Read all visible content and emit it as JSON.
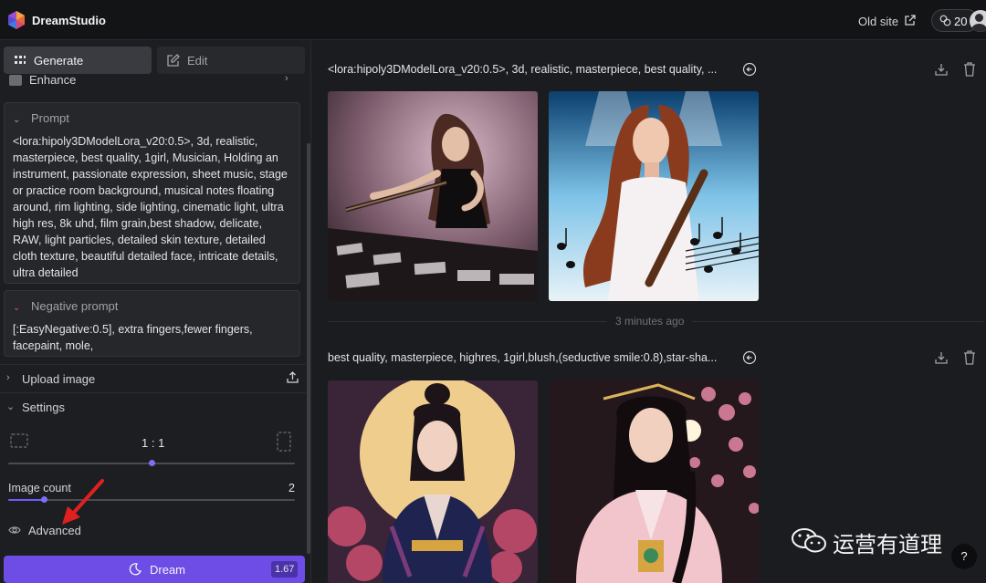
{
  "app": {
    "name": "DreamStudio"
  },
  "topbar": {
    "old_site_label": "Old site",
    "credits": "20"
  },
  "tabs": {
    "generate": "Generate",
    "edit": "Edit"
  },
  "sidebar": {
    "enhance_label": "Enhance",
    "prompt": {
      "header": "Prompt",
      "text": "<lora:hipoly3DModelLora_v20:0.5>, 3d, realistic, masterpiece, best quality, 1girl, Musician, Holding an instrument, passionate expression, sheet music, stage or practice room background, musical notes floating around, rim lighting, side lighting, cinematic light, ultra high res, 8k uhd, film grain,best shadow, delicate, RAW, light particles, detailed skin texture, detailed cloth texture, beautiful detailed face, intricate details, ultra detailed"
    },
    "negative_prompt": {
      "header": "Negative prompt",
      "text": "[:EasyNegative:0.5], extra fingers,fewer fingers, facepaint, mole,"
    },
    "upload_image_label": "Upload image",
    "settings": {
      "label": "Settings",
      "aspect_ratio": "1 : 1",
      "aspect_ratio_position": 0.5,
      "image_count_label": "Image count",
      "image_count_value": "2",
      "image_count_position": 0.125
    },
    "advanced_label": "Advanced",
    "dream_button": {
      "label": "Dream",
      "cost": "1.67"
    }
  },
  "main": {
    "generations": [
      {
        "prompt": "<lora:hipoly3DModelLora_v20:0.5>, 3d, realistic, masterpiece, best quality, ...",
        "images": [
          "musician-violin-image",
          "musician-sheet-music-image"
        ]
      },
      {
        "time_label": "3 minutes ago",
        "prompt": "best quality, masterpiece, highres, 1girl,blush,(seductive smile:0.8),star-sha...",
        "images": [
          "hanfu-moon-image",
          "hanfu-blossom-image"
        ]
      }
    ],
    "watermark": "运营有道理",
    "help_label": "?"
  },
  "colors": {
    "accent": "#6d4de6",
    "slider": "#6d5dfc",
    "arrow": "#e02020"
  }
}
